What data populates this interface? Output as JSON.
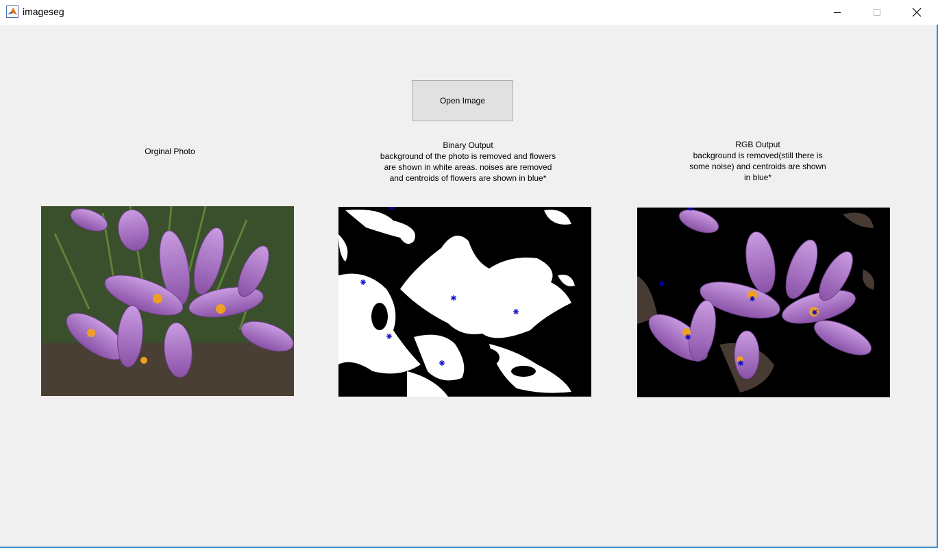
{
  "window": {
    "title": "imageseg",
    "controls": [
      "minimize",
      "maximize",
      "close"
    ]
  },
  "toolbar": {
    "open_label": "Open Image"
  },
  "panels": {
    "original": {
      "label": "Orginal Photo"
    },
    "binary": {
      "label_lines": [
        "Binary Output",
        "background of the photo is removed and flowers",
        "are shown in white areas. noises are removed",
        "and centroids of flowers are shown in blue*"
      ]
    },
    "rgb": {
      "label_lines": [
        "RGB Output",
        "background is removed(still there is",
        "some noise) and centroids are shown",
        "in blue*"
      ]
    }
  },
  "colors": {
    "window_bg": "#f0f0f0",
    "button_bg": "#e1e1e1",
    "centroid_marker": "#0000cc",
    "flower_petal": "#b07ad0",
    "stamen": "#f0a020",
    "foliage": "#3d5a2a"
  }
}
